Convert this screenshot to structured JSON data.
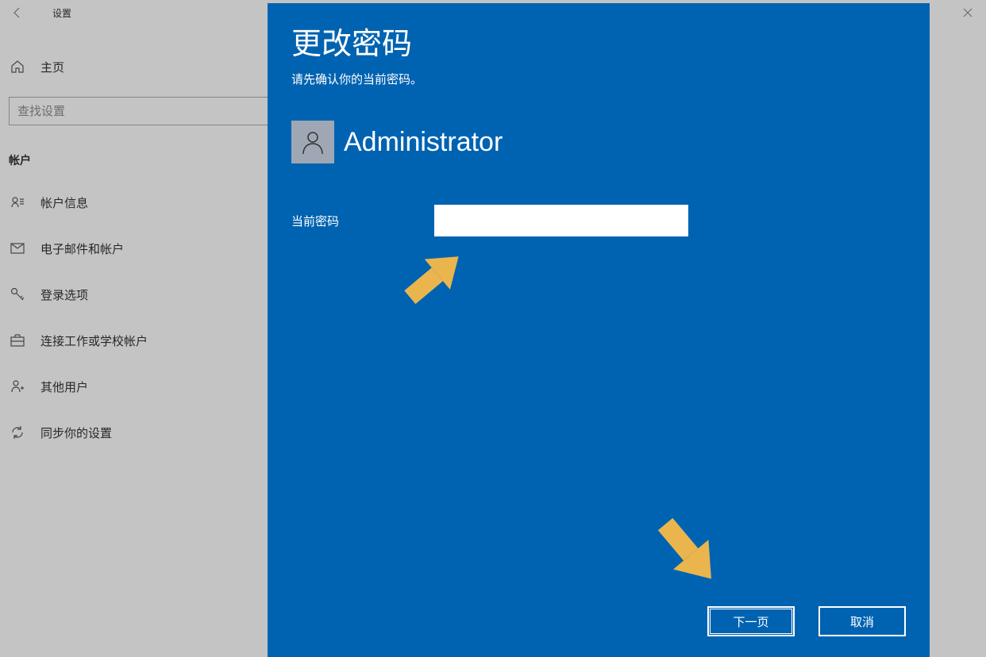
{
  "window": {
    "title": "设置"
  },
  "home": {
    "label": "主页"
  },
  "search": {
    "placeholder": "查找设置"
  },
  "section": {
    "header": "帐户"
  },
  "nav": {
    "items": [
      {
        "label": "帐户信息"
      },
      {
        "label": "电子邮件和帐户"
      },
      {
        "label": "登录选项"
      },
      {
        "label": "连接工作或学校帐户"
      },
      {
        "label": "其他用户"
      },
      {
        "label": "同步你的设置"
      }
    ]
  },
  "dialog": {
    "title": "更改密码",
    "subtitle": "请先确认你的当前密码。",
    "user_name": "Administrator",
    "field_label": "当前密码",
    "password_value": "",
    "next_btn": "下一页",
    "cancel_btn": "取消"
  },
  "colors": {
    "dialog_bg": "#0063B1",
    "arrow": "#eab54d"
  }
}
